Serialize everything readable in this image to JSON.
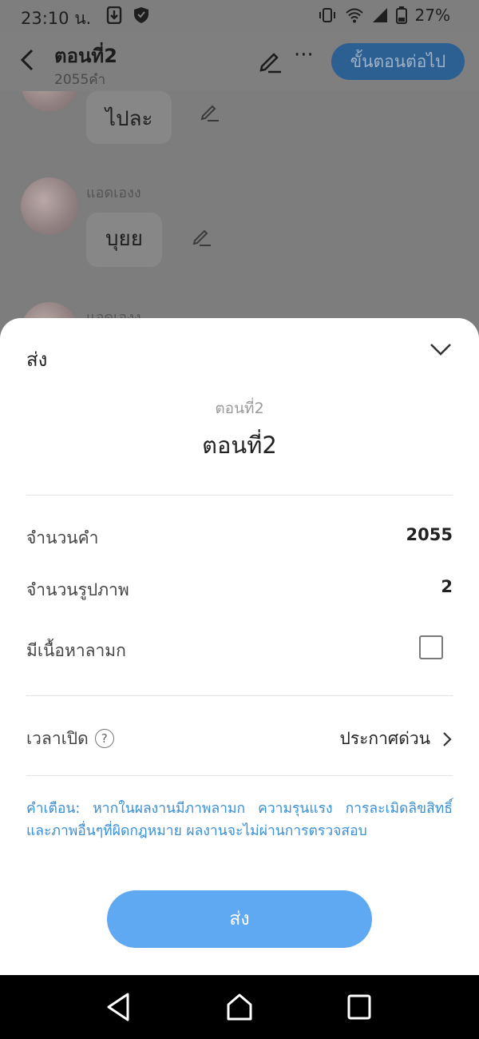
{
  "status_bar": {
    "time": "23:10 น.",
    "battery": "27%"
  },
  "header": {
    "title": "ตอนที่2",
    "subtitle": "2055คำ",
    "next_label": "ขั้นตอนต่อไป"
  },
  "chat": {
    "messages": [
      {
        "text": "ไปละ"
      },
      {
        "sender": "แอดเองง",
        "text": "บุยย"
      },
      {
        "sender": "แอดเองง"
      }
    ]
  },
  "sheet": {
    "title": "ส่ง",
    "chapter_small": "ตอนที่2",
    "chapter_big": "ตอนที่2",
    "word_count_label": "จำนวนคำ",
    "word_count_value": "2055",
    "image_count_label": "จำนวนรูปภาพ",
    "image_count_value": "2",
    "nsfw_label": "มีเนื้อหาลามก",
    "nsfw_checked": false,
    "open_time_label": "เวลาเปิด",
    "open_time_value": "ประกาศด่วน",
    "warning": "คำเตือน: หากในผลงานมีภาพลามก ความรุนแรง การละเมิดลิขสิทธิ์และภาพอื่นๆที่ผิดกฎหมาย ผลงานจะไม่ผ่านการตรวจสอบ",
    "send_label": "ส่ง"
  },
  "colors": {
    "accent": "#5fa8f2",
    "warning_text": "#3b8fd6"
  }
}
